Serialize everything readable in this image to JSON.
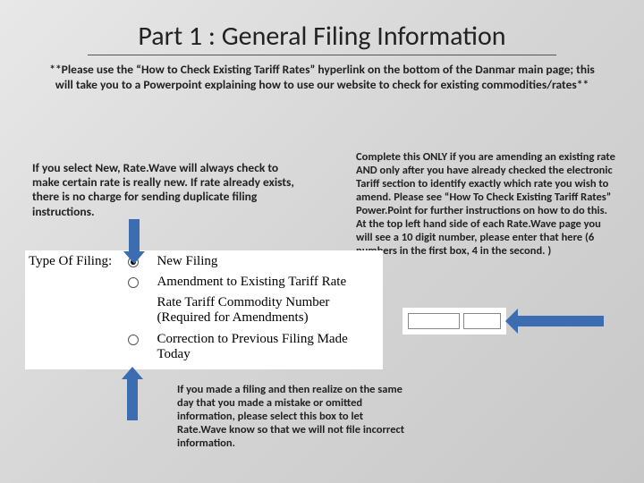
{
  "title": "Part 1 : General Filing Information",
  "notice": "**Please use the “How to Check Existing Tariff Rates” hyperlink on the bottom of the Danmar main page; this will take you to a Powerpoint explaining how to use our website to check for existing commodities/rates**",
  "left_desc": "If you select New, Rate.Wave will always check to make certain rate is really new. If rate already exists, there is no charge for sending duplicate filing instructions.",
  "right_desc": "Complete this ONLY if you are amending an existing rate AND only after you have already checked the electronic Tariff section to identify exactly which rate you wish to amend. Please see “How To Check Existing Tariff Rates” Power.Point for further instructions on how to do this. At the top left hand side of each Rate.Wave page you will see a 10 digit number, please enter that here (6 numbers in the first box, 4 in the second. )",
  "form": {
    "label": "Type Of Filing:",
    "options": [
      "New Filing",
      "Amendment to Existing Tariff Rate",
      "Rate Tariff Commodity Number (Required for Amendments)",
      "Correction to Previous Filing Made Today"
    ]
  },
  "bottom_desc": "If you made a filing and then realize on the same day that you made a mistake or omitted information, please select this box to let Rate.Wave know so that we will not file incorrect information."
}
